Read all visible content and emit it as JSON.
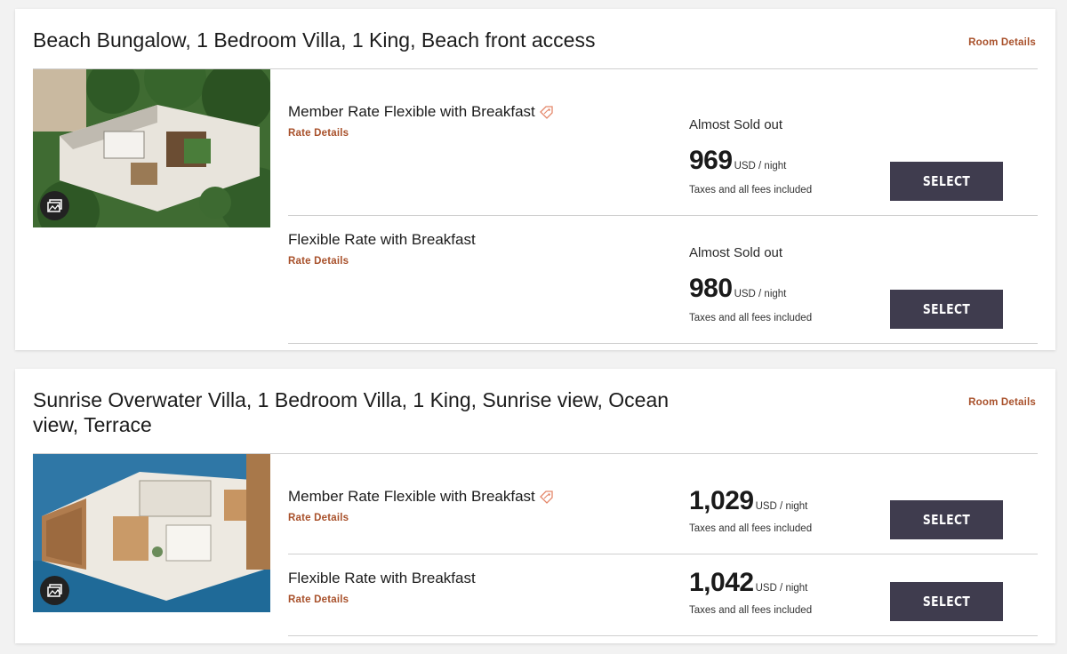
{
  "rooms": [
    {
      "title": "Beach Bungalow, 1 Bedroom Villa, 1 King, Beach front access",
      "details_link": "Room Details",
      "image_icon": "gallery-icon",
      "rates": [
        {
          "name": "Member Rate Flexible with Breakfast",
          "member_icon": "tag-icon",
          "link": "Rate Details",
          "availability": "Almost Sold out",
          "price": "969",
          "unit": "USD / night",
          "taxes": "Taxes and all fees included",
          "button": "SELECT"
        },
        {
          "name": "Flexible Rate with Breakfast",
          "link": "Rate Details",
          "availability": "Almost Sold out",
          "price": "980",
          "unit": "USD / night",
          "taxes": "Taxes and all fees included",
          "button": "SELECT"
        }
      ]
    },
    {
      "title_line1": "Sunrise Overwater Villa, 1 Bedroom Villa, 1 King, Sunrise view, Ocean",
      "title_line2": "view, Terrace",
      "details_link": "Room Details",
      "image_icon": "gallery-icon",
      "rates": [
        {
          "name": "Member Rate Flexible with Breakfast",
          "member_icon": "tag-icon",
          "link": "Rate Details",
          "price": "1,029",
          "unit": "USD / night",
          "taxes": "Taxes and all fees included",
          "button": "SELECT"
        },
        {
          "name": "Flexible Rate with Breakfast",
          "link": "Rate Details",
          "price": "1,042",
          "unit": "USD / night",
          "taxes": "Taxes and all fees included",
          "button": "SELECT"
        }
      ]
    }
  ],
  "colors": {
    "accent_link": "#a8502a",
    "button_bg": "#3f3c4e",
    "tag_icon": "#e4876a"
  }
}
